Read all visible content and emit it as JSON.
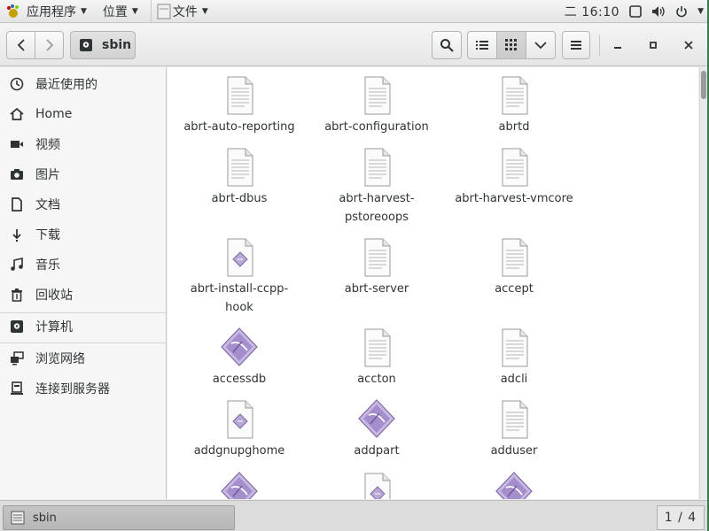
{
  "top_panel": {
    "apps_label": "应用程序",
    "places_label": "位置",
    "files_label": "文件",
    "clock": "二 16:10"
  },
  "headerbar": {
    "path_label": "sbin",
    "view_icons": [
      "list-view-icon",
      "grid-view-icon",
      "chevron-down-icon"
    ]
  },
  "sidebar": {
    "items": [
      {
        "label": "最近使用的",
        "icon": "clock-icon"
      },
      {
        "label": "Home",
        "icon": "home-icon"
      },
      {
        "label": "视频",
        "icon": "video-icon"
      },
      {
        "label": "图片",
        "icon": "camera-icon"
      },
      {
        "label": "文档",
        "icon": "document-icon"
      },
      {
        "label": "下载",
        "icon": "download-icon"
      },
      {
        "label": "音乐",
        "icon": "music-icon"
      },
      {
        "label": "回收站",
        "icon": "trash-icon"
      },
      {
        "label": "计算机",
        "icon": "drive-icon"
      },
      {
        "label": "浏览网络",
        "icon": "network-icon"
      },
      {
        "label": "连接到服务器",
        "icon": "server-icon"
      }
    ]
  },
  "files": [
    {
      "name1": "abrt-auto-reporting",
      "name2": "",
      "type": "text"
    },
    {
      "name1": "abrt-configuration",
      "name2": "",
      "type": "text"
    },
    {
      "name1": "abrtd",
      "name2": "",
      "type": "text"
    },
    {
      "name1": "abrt-dbus",
      "name2": "",
      "type": "text"
    },
    {
      "name1": "abrt-harvest-",
      "name2": "pstoreoops",
      "type": "text"
    },
    {
      "name1": "abrt-harvest-vmcore",
      "name2": "",
      "type": "text"
    },
    {
      "name1": "abrt-install-ccpp-",
      "name2": "hook",
      "type": "script"
    },
    {
      "name1": "abrt-server",
      "name2": "",
      "type": "text"
    },
    {
      "name1": "accept",
      "name2": "",
      "type": "text"
    },
    {
      "name1": "accessdb",
      "name2": "",
      "type": "exec"
    },
    {
      "name1": "accton",
      "name2": "",
      "type": "text"
    },
    {
      "name1": "adcli",
      "name2": "",
      "type": "text"
    },
    {
      "name1": "addgnupghome",
      "name2": "",
      "type": "script"
    },
    {
      "name1": "addpart",
      "name2": "",
      "type": "exec"
    },
    {
      "name1": "adduser",
      "name2": "",
      "type": "text"
    },
    {
      "name1": "",
      "name2": "",
      "type": "exec"
    },
    {
      "name1": "",
      "name2": "",
      "type": "script"
    },
    {
      "name1": "",
      "name2": "",
      "type": "exec"
    }
  ],
  "bottombar": {
    "task_label": "sbin",
    "pager": "1 / 4"
  }
}
